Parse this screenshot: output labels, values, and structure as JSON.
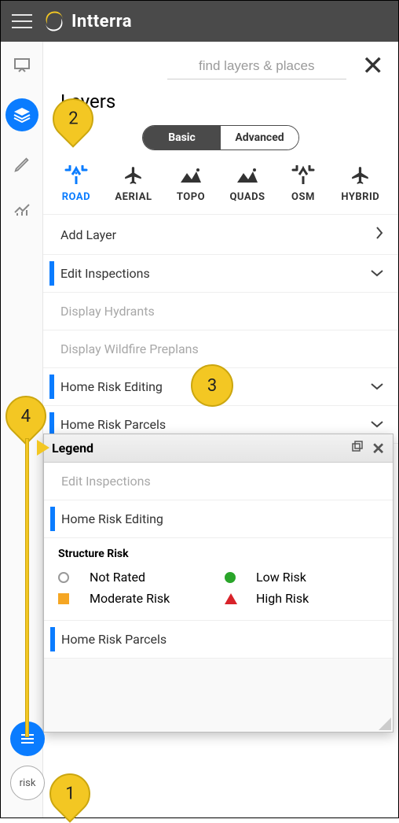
{
  "header": {
    "brand": "Intterra"
  },
  "search": {
    "placeholder": "find layers & places"
  },
  "panel": {
    "title": "Layers",
    "toggle": {
      "basic": "Basic",
      "advanced": "Advanced"
    },
    "map_types": {
      "road": "ROAD",
      "aerial": "AERIAL",
      "topo": "TOPO",
      "quads": "QUADS",
      "osm": "OSM",
      "hybrid": "HYBRID"
    },
    "rows": {
      "add_layer": "Add Layer",
      "edit_inspections": "Edit Inspections",
      "display_hydrants": "Display Hydrants",
      "display_wildfire_preplans": "Display Wildfire Preplans",
      "home_risk_editing": "Home Risk Editing",
      "home_risk_parcels": "Home Risk Parcels"
    }
  },
  "legend": {
    "title": "Legend",
    "rows": {
      "edit_inspections": "Edit Inspections",
      "home_risk_editing": "Home Risk Editing",
      "home_risk_parcels": "Home Risk Parcels"
    },
    "structure_risk": {
      "title": "Structure Risk",
      "not_rated": "Not Rated",
      "low_risk": "Low Risk",
      "moderate_risk": "Moderate Risk",
      "high_risk": "High Risk"
    }
  },
  "float": {
    "risk_label": "risk"
  },
  "callouts": {
    "c1": "1",
    "c2": "2",
    "c3": "3",
    "c4": "4"
  }
}
